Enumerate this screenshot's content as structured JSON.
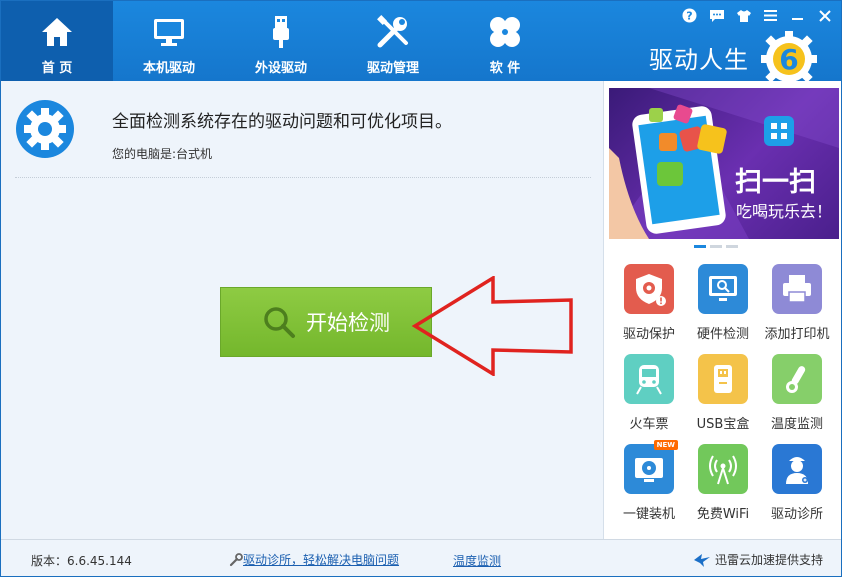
{
  "nav": {
    "items": [
      {
        "label": "首 页",
        "icon": "home-icon",
        "active": true
      },
      {
        "label": "本机驱动",
        "icon": "monitor-icon"
      },
      {
        "label": "外设驱动",
        "icon": "usb-icon"
      },
      {
        "label": "驱动管理",
        "icon": "tools-icon"
      },
      {
        "label": "软 件",
        "icon": "software-icon"
      }
    ]
  },
  "window_controls": [
    "help-icon",
    "feedback-icon",
    "skin-icon",
    "menu-icon",
    "minimize-icon",
    "close-icon"
  ],
  "brand": {
    "name": "驱动人生",
    "version_digit": "6",
    "accent": "#f6c21c"
  },
  "main": {
    "title": "全面检测系统存在的驱动问题和可优化项目。",
    "subtitle": "您的电脑是:台式机",
    "start_button": "开始检测"
  },
  "banner": {
    "headline": "扫一扫",
    "tagline": "吃喝玩乐去！"
  },
  "tools": [
    {
      "label": "驱动保护",
      "icon": "shield-gear-icon",
      "color": "#e35c4e"
    },
    {
      "label": "硬件检测",
      "icon": "hardware-monitor-icon",
      "color": "#2d8ad8"
    },
    {
      "label": "添加打印机",
      "icon": "printer-icon",
      "color": "#8e8ad6"
    },
    {
      "label": "火车票",
      "icon": "train-icon",
      "color": "#5fcfc2"
    },
    {
      "label": "USB宝盒",
      "icon": "usb-box-icon",
      "color": "#f4c34a"
    },
    {
      "label": "温度监测",
      "icon": "thermometer-icon",
      "color": "#86cf6a"
    },
    {
      "label": "一键装机",
      "icon": "install-disc-icon",
      "color": "#2d8ad8",
      "badge": "NEW"
    },
    {
      "label": "免费WiFi",
      "icon": "wifi-antenna-icon",
      "color": "#72c85b"
    },
    {
      "label": "驱动诊所",
      "icon": "doctor-icon",
      "color": "#2a78d4"
    }
  ],
  "footer": {
    "version": "版本：6.6.45.144",
    "clinic_link": "驱动诊所，轻松解决电脑问题",
    "temp_link": "温度监测",
    "cloud": "迅雷云加速提供支持"
  },
  "colors": {
    "header": "#1b87de",
    "active_tab": "#0e5fae",
    "start_button": "#7dbd33",
    "arrow": "#e0231f"
  }
}
